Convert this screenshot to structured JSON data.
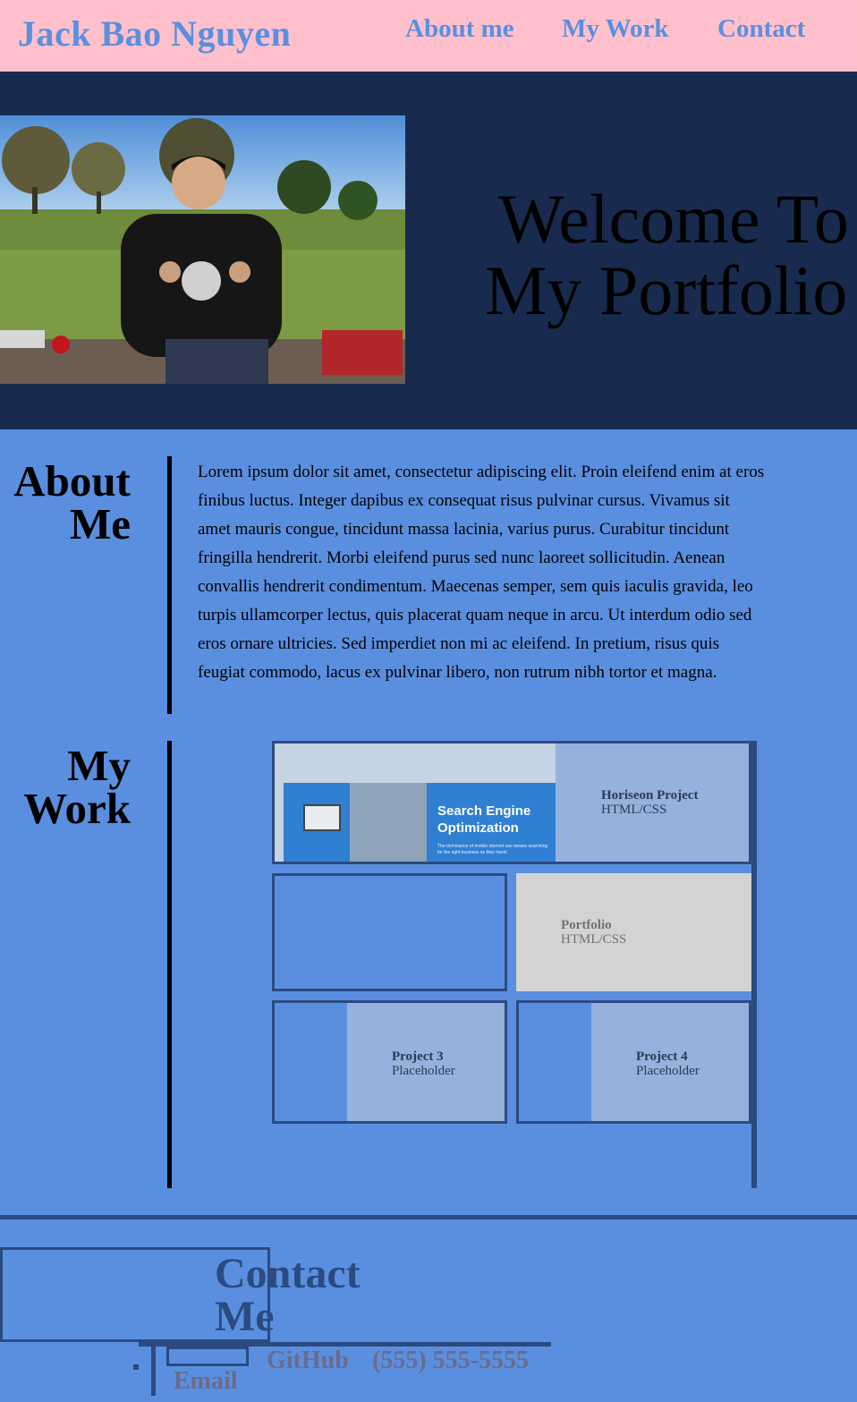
{
  "header": {
    "brand": "Jack Bao Nguyen",
    "nav": [
      "About me",
      "My Work",
      "Contact"
    ]
  },
  "hero": {
    "title_line1": "Welcome To",
    "title_line2": "My Portfolio"
  },
  "about": {
    "title_line1": "About",
    "title_line2": "Me",
    "body": "Lorem ipsum dolor sit amet, consectetur adipiscing elit. Proin eleifend enim at eros finibus luctus. Integer dapibus ex consequat risus pulvinar cursus. Vivamus sit amet mauris congue, tincidunt massa lacinia, varius purus. Curabitur tincidunt fringilla hendrerit. Morbi eleifend purus sed nunc laoreet sollicitudin. Aenean convallis hendrerit condimentum. Maecenas semper, sem quis iaculis gravida, leo turpis ullamcorper lectus, quis placerat quam neque in arcu. Ut interdum odio sed eros ornare ultricies. Sed imperdiet non mi ac eleifend. In pretium, risus quis feugiat commodo, lacus ex pulvinar libero, non rutrum nibh tortor et magna."
  },
  "work": {
    "title_line1": "My",
    "title_line2": "Work",
    "projects": [
      {
        "name": "Horiseon Project",
        "tech": "HTML/CSS",
        "thumb_title": "Search Engine Optimization",
        "thumb_sub": "The dominance of mobile internet use means searching for the right business as they travel"
      },
      {
        "name": "Portfolio",
        "tech": "HTML/CSS"
      },
      {
        "name": "Project 3",
        "tech": "Placeholder"
      },
      {
        "name": "Project 4",
        "tech": "Placeholder"
      }
    ]
  },
  "contact": {
    "title_line1": "Contact",
    "title_line2": "Me",
    "email": "Email",
    "github": "GitHub",
    "phone": "(555) 555-5555"
  },
  "colors": {
    "header_bg": "#ffc0cb",
    "accent_blue": "#5a8fe0",
    "hero_bg": "#182b4e",
    "border_navy": "#2b4a80"
  }
}
